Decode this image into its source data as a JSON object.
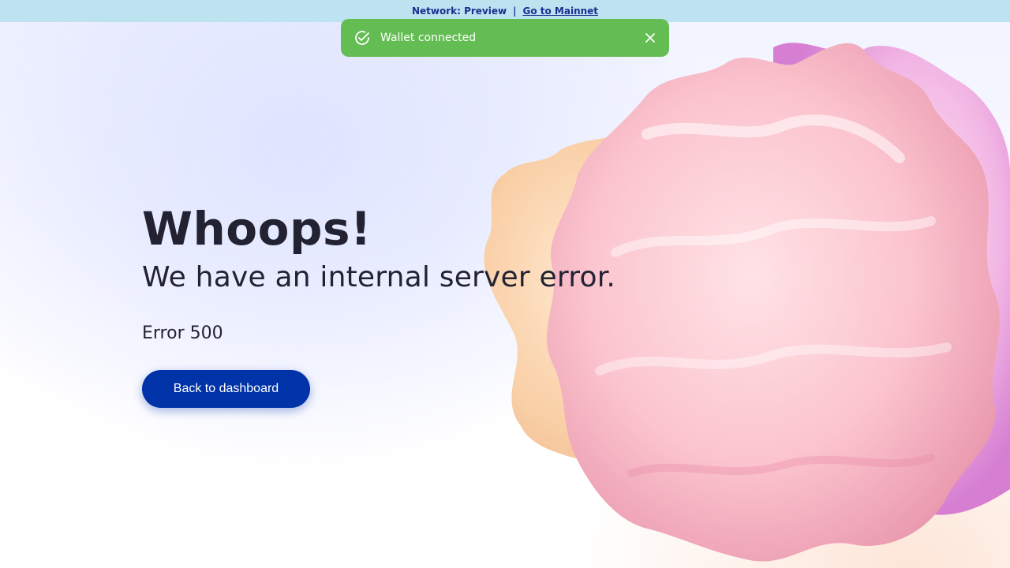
{
  "banner": {
    "network_text": "Network: Preview",
    "separator": "|",
    "mainnet_link": "Go to Mainnet",
    "icon": "none"
  },
  "toast": {
    "message": "Wallet connected",
    "status_icon": "check-circle-icon",
    "close_icon": "close-icon",
    "color": "#64bd52"
  },
  "main": {
    "headline": "Whoops!",
    "subheadline": "We have an internal server error.",
    "error_code": "Error 500",
    "back_button_label": "Back to dashboard"
  },
  "colors": {
    "banner_bg": "#bde3f1",
    "primary_button": "#0033a8",
    "text": "#222233"
  }
}
